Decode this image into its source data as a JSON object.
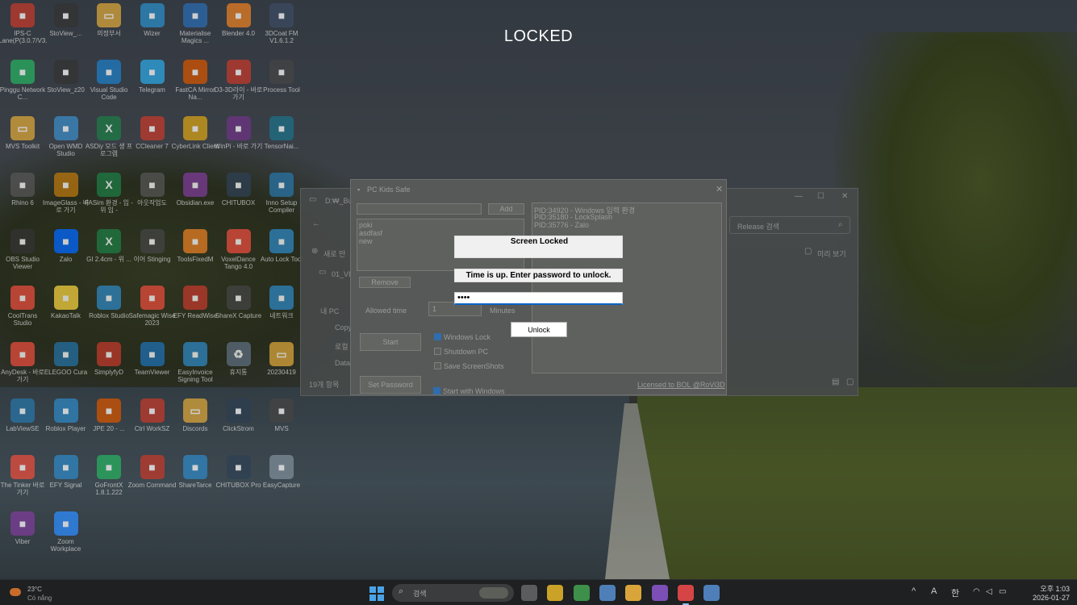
{
  "lock_screen": {
    "title": "LOCKED",
    "dialog_title": "Screen Locked",
    "message": "Time is up. Enter password to unlock.",
    "password_value": "••••",
    "unlock_label": "Unlock"
  },
  "app": {
    "title": "PC Kids Safe",
    "close_glyph": "✕",
    "add_label": "Add",
    "remove_label": "Remove",
    "programs": [
      "poki",
      "asdfasf",
      "new"
    ],
    "allowed_time_label": "Allowed time",
    "allowed_time_value": "1",
    "minutes_label": "Minutes",
    "start_label": "Start",
    "set_password_label": "Set Password",
    "options": [
      {
        "label": "Windows Lock",
        "checked": true
      },
      {
        "label": "Shutdown PC",
        "checked": false
      },
      {
        "label": "Save ScreenShots",
        "checked": false
      }
    ],
    "start_with_windows": {
      "label": "Start with Windows",
      "checked": true
    },
    "processes": [
      "PID:34920 - Windows 입력 환경",
      "PID:35180 - LockSplash",
      "PID:35776 - Zalo"
    ],
    "license": "Licensed to BOL @RoVi3D"
  },
  "explorer": {
    "path": "D:₩_Bu",
    "new_label": "새로 만",
    "search_placeholder": "Release 검색",
    "preview_label": "미리 보기",
    "folder_label": "01_VI",
    "tree": [
      "내 PC",
      "Copy",
      "로컬",
      "Data"
    ],
    "item_count": "19개 항목"
  },
  "desktop_icons": [
    {
      "label": "IPS-C Lane(P(3.0.7/V3.0.2)",
      "icon": "app-icon",
      "color": "#c0392b"
    },
    {
      "label": "StoView_...",
      "icon": "app-icon",
      "color": "#333333"
    },
    {
      "label": "의정부서",
      "icon": "folder-icon",
      "color": "#d9a53a"
    },
    {
      "label": "Wizer",
      "icon": "app-icon",
      "color": "#2a8cc4"
    },
    {
      "label": "Materialise Magics ...",
      "icon": "app-icon",
      "color": "#2a6bb0"
    },
    {
      "label": "Blender 4.0",
      "icon": "app-icon",
      "color": "#e67e22"
    },
    {
      "label": "3DCoat FM V1.6.1.2",
      "icon": "app-icon",
      "color": "#3b4a63"
    },
    {
      "label": "Pinggu Network C...",
      "icon": "app-icon",
      "color": "#27ae60"
    },
    {
      "label": "StoView_z20",
      "icon": "app-icon",
      "color": "#333333"
    },
    {
      "label": "Visual Studio Code",
      "icon": "app-icon",
      "color": "#1f7cc4"
    },
    {
      "label": "Telegram",
      "icon": "app-icon",
      "color": "#2ca5e0"
    },
    {
      "label": "FastCA Mirror Na...",
      "icon": "app-icon",
      "color": "#d35400"
    },
    {
      "label": "D3-3D라이 - 바로 가기",
      "icon": "app-icon",
      "color": "#c0392b"
    },
    {
      "label": "Process Tool",
      "icon": "app-icon",
      "color": "#444444"
    },
    {
      "label": "MVS Toolkit",
      "icon": "folder-icon",
      "color": "#d9a53a"
    },
    {
      "label": "Open WMD Studio",
      "icon": "app-icon",
      "color": "#3b8ac4"
    },
    {
      "label": "ASDiy 모드 생 프로그램",
      "icon": "excel-icon",
      "color": "#1e7b45"
    },
    {
      "label": "CCleaner 7",
      "icon": "app-icon",
      "color": "#c0392b"
    },
    {
      "label": "CyberLink Client",
      "icon": "app-icon",
      "color": "#d4a017"
    },
    {
      "label": "WinPi - 바로 가기",
      "icon": "app-icon",
      "color": "#6c3483"
    },
    {
      "label": "TensorNai...",
      "icon": "app-icon",
      "color": "#1e6f87"
    },
    {
      "label": "Rhino 6",
      "icon": "app-icon",
      "color": "#555555"
    },
    {
      "label": "ImageGlass - 바로 가기",
      "icon": "app-icon",
      "color": "#b9770e"
    },
    {
      "label": "FASim 환경 - 임 - 위 임 -",
      "icon": "excel-icon",
      "color": "#1e7b45"
    },
    {
      "label": "아웃작업도",
      "icon": "app-icon",
      "color": "#555555"
    },
    {
      "label": "Obsidian.exe",
      "icon": "app-icon",
      "color": "#7d3c98"
    },
    {
      "label": "CHITUBOX",
      "icon": "app-icon",
      "color": "#2e4053"
    },
    {
      "label": "Inno Setup Compiler",
      "icon": "app-icon",
      "color": "#2874a6"
    },
    {
      "label": "OBS Studio Viewer",
      "icon": "app-icon",
      "color": "#333333"
    },
    {
      "label": "Zalo",
      "icon": "app-icon",
      "color": "#0068ff"
    },
    {
      "label": "GI 2.4cm - 위 ...",
      "icon": "excel-icon",
      "color": "#1e7b45"
    },
    {
      "label": "이어 Stinging",
      "icon": "app-icon",
      "color": "#444444"
    },
    {
      "label": "ToolsFixedM",
      "icon": "app-icon",
      "color": "#e67e22"
    },
    {
      "label": "VoxelDance Tango 4.0",
      "icon": "app-icon",
      "color": "#e74c3c"
    },
    {
      "label": "Auto Lock Tool",
      "icon": "app-icon",
      "color": "#2e86c1"
    },
    {
      "label": "CoolTrans Studio",
      "icon": "app-icon",
      "color": "#e74c3c"
    },
    {
      "label": "KakaoTalk",
      "icon": "app-icon",
      "color": "#f4d03f"
    },
    {
      "label": "Roblox Studio",
      "icon": "app-icon",
      "color": "#2e86c1"
    },
    {
      "label": "Safemagic Wise 2023",
      "icon": "app-icon",
      "color": "#e74c3c"
    },
    {
      "label": "EFY ReadWise",
      "icon": "app-icon",
      "color": "#c0392b"
    },
    {
      "label": "ShareX Capture",
      "icon": "app-icon",
      "color": "#444444"
    },
    {
      "label": "네트워크",
      "icon": "app-icon",
      "color": "#2e86c1"
    },
    {
      "label": "AnyDesk - 바로 가기",
      "icon": "app-icon",
      "color": "#e74c3c"
    },
    {
      "label": "ELEGOO Cura",
      "icon": "app-icon",
      "color": "#2471a3"
    },
    {
      "label": "SimplyfyD",
      "icon": "app-icon",
      "color": "#c0392b"
    },
    {
      "label": "TeamViewer",
      "icon": "app-icon",
      "color": "#1f6fb2"
    },
    {
      "label": "EasyInvoice Signing Tool",
      "icon": "app-icon",
      "color": "#2e86c1"
    },
    {
      "label": "휴지통",
      "icon": "recycle-bin-icon",
      "color": "#5d6d7e"
    },
    {
      "label": "20230419",
      "icon": "folder-icon",
      "color": "#d9a53a"
    },
    {
      "label": "LabViewSE",
      "icon": "app-icon",
      "color": "#2874a6"
    },
    {
      "label": "Roblox Player",
      "icon": "app-icon",
      "color": "#2e86c1"
    },
    {
      "label": "JPE 20 - ...",
      "icon": "app-icon",
      "color": "#d35400"
    },
    {
      "label": "Ctrl WorkSZ",
      "icon": "app-icon",
      "color": "#c0392b"
    },
    {
      "label": "Discords",
      "icon": "folder-icon",
      "color": "#d9a53a"
    },
    {
      "label": "ClickStrom",
      "icon": "app-icon",
      "color": "#2c3e50"
    },
    {
      "label": "MVS",
      "icon": "app-icon",
      "color": "#444444"
    },
    {
      "label": "The Tinker 바로 가기",
      "icon": "app-icon",
      "color": "#e74c3c"
    },
    {
      "label": "EFY Signal",
      "icon": "app-icon",
      "color": "#2e86c1"
    },
    {
      "label": "GoFrontX 1.8.1.222",
      "icon": "app-icon",
      "color": "#27ae60"
    },
    {
      "label": "Zoom Command",
      "icon": "app-icon",
      "color": "#c0392b"
    },
    {
      "label": "ShareTarce",
      "icon": "app-icon",
      "color": "#2e86c1"
    },
    {
      "label": "CHITUBOX Pro",
      "icon": "app-icon",
      "color": "#2e4053"
    },
    {
      "label": "EasyCapture",
      "icon": "app-icon",
      "color": "#7d8c99"
    },
    {
      "label": "Viber",
      "icon": "app-icon",
      "color": "#7d3c98"
    },
    {
      "label": "Zoom Workplace",
      "icon": "app-icon",
      "color": "#2d8cff"
    }
  ],
  "taskbar": {
    "weather_temp": "23°C",
    "weather_desc": "Có nắng",
    "search_label": "검색",
    "apps": [
      {
        "name": "task-view",
        "color": "#5a5c5e"
      },
      {
        "name": "sticky-notes",
        "color": "#c9a227"
      },
      {
        "name": "chrome",
        "color": "#3d8f4a"
      },
      {
        "name": "notepad",
        "color": "#4f7fb8"
      },
      {
        "name": "file-explorer",
        "color": "#d9a53a"
      },
      {
        "name": "visual-studio",
        "color": "#7b4fb5"
      },
      {
        "name": "pc-kids-safe",
        "color": "#d64545"
      },
      {
        "name": "lock-app",
        "color": "#4f7fb8"
      }
    ],
    "tray_chevron": "^",
    "tray_a": "A",
    "tray_ime": "한",
    "clock_time": "오후 1:03",
    "clock_date": "2026-01-27"
  }
}
